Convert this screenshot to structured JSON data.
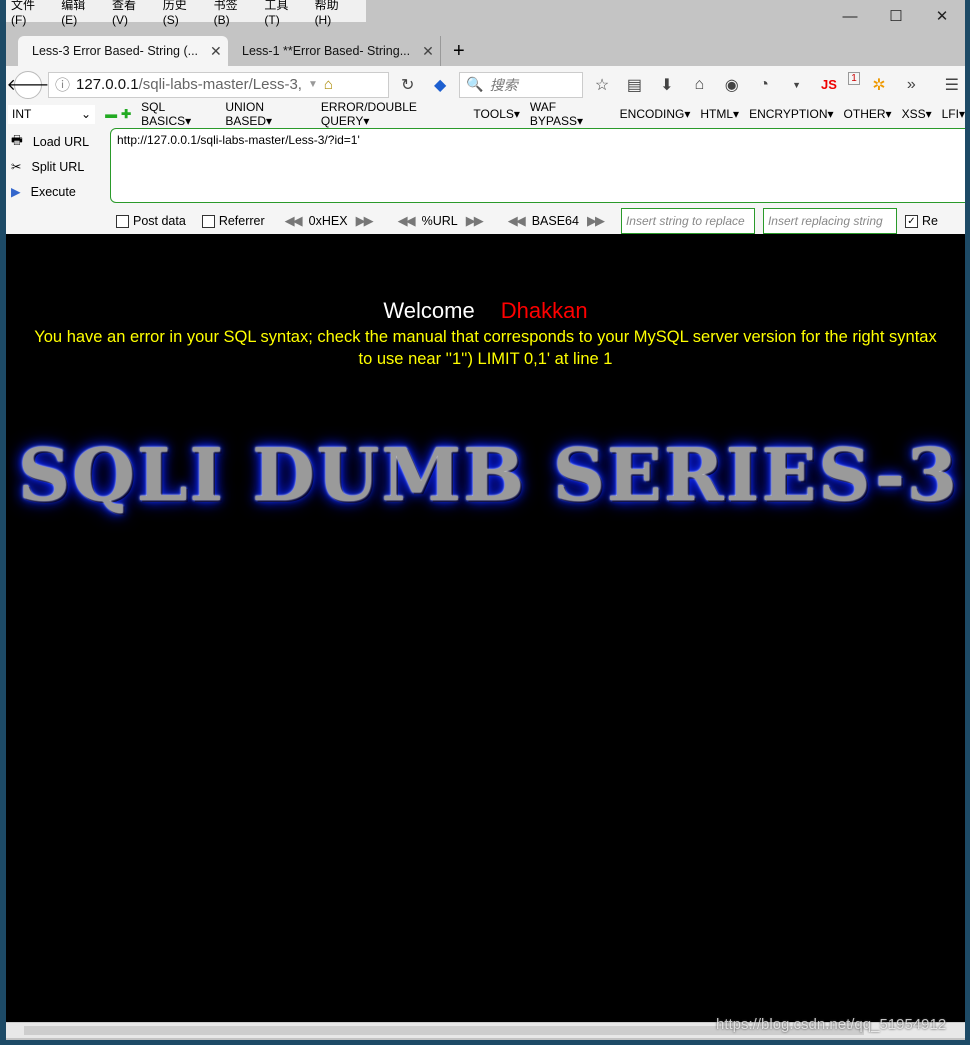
{
  "menu": [
    "文件(F)",
    "编辑(E)",
    "查看(V)",
    "历史(S)",
    "书签(B)",
    "工具(T)",
    "帮助(H)"
  ],
  "tabs": [
    {
      "label": "Less-3 Error Based- String (..."
    },
    {
      "label": "Less-1 **Error Based- String..."
    }
  ],
  "nav": {
    "url_host": "127.0.0.1",
    "url_path": "/sqli-labs-master/Less-3,",
    "search_placeholder": "搜索",
    "badge": "1",
    "js": "JS"
  },
  "hackbar": {
    "type_select": "INT",
    "menus": [
      "SQL BASICS▾",
      "UNION BASED▾",
      "ERROR/DOUBLE QUERY▾",
      "TOOLS▾",
      "WAF BYPASS▾",
      "ENCODING▾",
      "HTML▾",
      "ENCRYPTION▾",
      "OTHER▾",
      "XSS▾",
      "LFI▾"
    ],
    "load_url": "Load URL",
    "split_url": "Split URL",
    "execute": "Execute",
    "url_value": "http://127.0.0.1/sqli-labs-master/Less-3/?id=1'",
    "post_data": "Post data",
    "referrer": "Referrer",
    "hex": "0xHEX",
    "urlenc": "%URL",
    "base64": "BASE64",
    "replace_placeholder": "Insert string to replace",
    "replacing_placeholder": "Insert replacing string",
    "replace_all": "Re"
  },
  "page": {
    "welcome": "Welcome",
    "name": "Dhakkan",
    "error": "You have an error in your SQL syntax; check the manual that corresponds to your MySQL server version for the right syntax to use near ''1'') LIMIT 0,1' at line 1",
    "banner": "SQLI DUMB SERIES-3"
  },
  "watermark": "https://blog.csdn.net/qq_51954912"
}
